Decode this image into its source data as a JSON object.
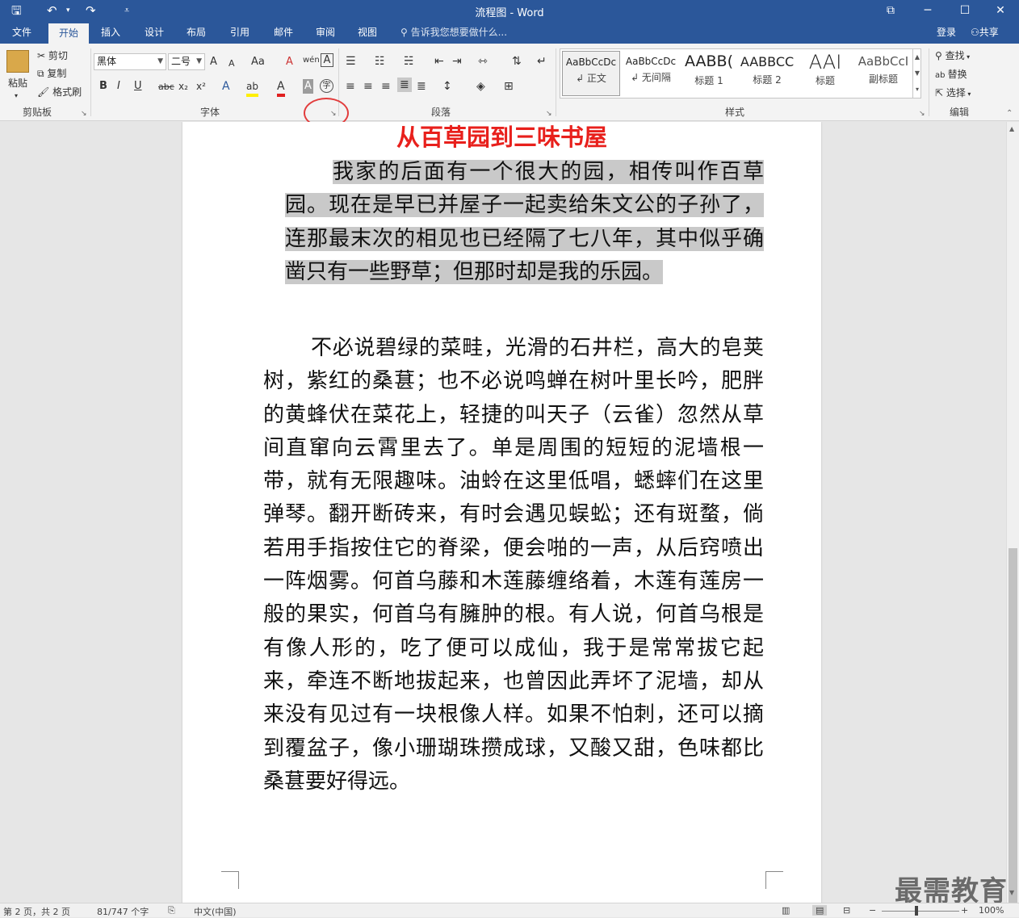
{
  "window": {
    "title": "流程图 - Word",
    "qa_save": "🖫",
    "qa_undo": "↶",
    "qa_redo": "↷",
    "qa_more": "⩡",
    "ctrl_restore": "⧉",
    "ctrl_min": "─",
    "ctrl_max": "☐",
    "ctrl_close": "✕"
  },
  "tabs": [
    {
      "label": "文件"
    },
    {
      "label": "开始"
    },
    {
      "label": "插入"
    },
    {
      "label": "设计"
    },
    {
      "label": "布局"
    },
    {
      "label": "引用"
    },
    {
      "label": "邮件"
    },
    {
      "label": "审阅"
    },
    {
      "label": "视图"
    }
  ],
  "tell_me": "告诉我您想要做什么...",
  "account": {
    "login": "登录",
    "share": "共享"
  },
  "clipboard": {
    "paste": "粘贴",
    "cut": "剪切",
    "copy": "复制",
    "format_painter": "格式刷",
    "label": "剪贴板"
  },
  "font": {
    "name": "黑体",
    "size": "二号",
    "label": "字体",
    "grow": "A",
    "shrink": "A",
    "case": "Aa",
    "clear": "A",
    "phonetic": "wén",
    "border": "A",
    "bold": "B",
    "italic": "I",
    "underline": "U",
    "strike": "abc",
    "sub": "x₂",
    "sup": "x²",
    "effects": "A",
    "highlight": "ab",
    "color": "A",
    "shade": "A",
    "enclose": "字"
  },
  "paragraph": {
    "label": "段落"
  },
  "styles": {
    "label": "样式",
    "items": [
      {
        "preview": "AaBbCcDc",
        "name": "↲ 正文"
      },
      {
        "preview": "AaBbCcDc",
        "name": "↲ 无间隔"
      },
      {
        "preview": "AABB(",
        "name": "标题 1"
      },
      {
        "preview": "AABBCC",
        "name": "标题 2"
      },
      {
        "preview": "AAI",
        "name": "标题"
      },
      {
        "preview": "AaBbCcI",
        "name": "副标题"
      }
    ]
  },
  "editing": {
    "label": "编辑",
    "find": "查找",
    "replace": "替换",
    "select": "选择"
  },
  "document": {
    "title": "从百草园到三味书屋",
    "p1": "我家的后面有一个很大的园，相传叫作百草园。现在是早已并屋子一起卖给朱文公的子孙了，连那最末次的相见也已经隔了七八年，其中似乎确凿只有一些野草；但那时却是我的乐园。",
    "p2": "不必说碧绿的菜畦，光滑的石井栏，高大的皂荚树，紫红的桑葚；也不必说鸣蝉在树叶里长吟，肥胖的黄蜂伏在菜花上，轻捷的叫天子（云雀）忽然从草间直窜向云霄里去了。单是周围的短短的泥墙根一带，就有无限趣味。油蛉在这里低唱，蟋蟀们在这里弹琴。翻开断砖来，有时会遇见蜈蚣；还有斑蝥，倘若用手指按住它的脊梁，便会啪的一声，从后窍喷出一阵烟雾。何首乌藤和木莲藤缠络着，木莲有莲房一般的果实，何首乌有臃肿的根。有人说，何首乌根是有像人形的，吃了便可以成仙，我于是常常拔它起来，牵连不断地拔起来，也曾因此弄坏了泥墙，却从来没有见过有一块根像人样。如果不怕刺，还可以摘到覆盆子，像小珊瑚珠攒成球，又酸又甜，色味都比桑葚要好得远。"
  },
  "status": {
    "page": "第 2 页，共 2 页",
    "words": "81/747 个字",
    "lang": "中文(中国)",
    "zoom": "100%",
    "zoom_minus": "−",
    "zoom_plus": "+"
  },
  "watermark": "最需教育"
}
